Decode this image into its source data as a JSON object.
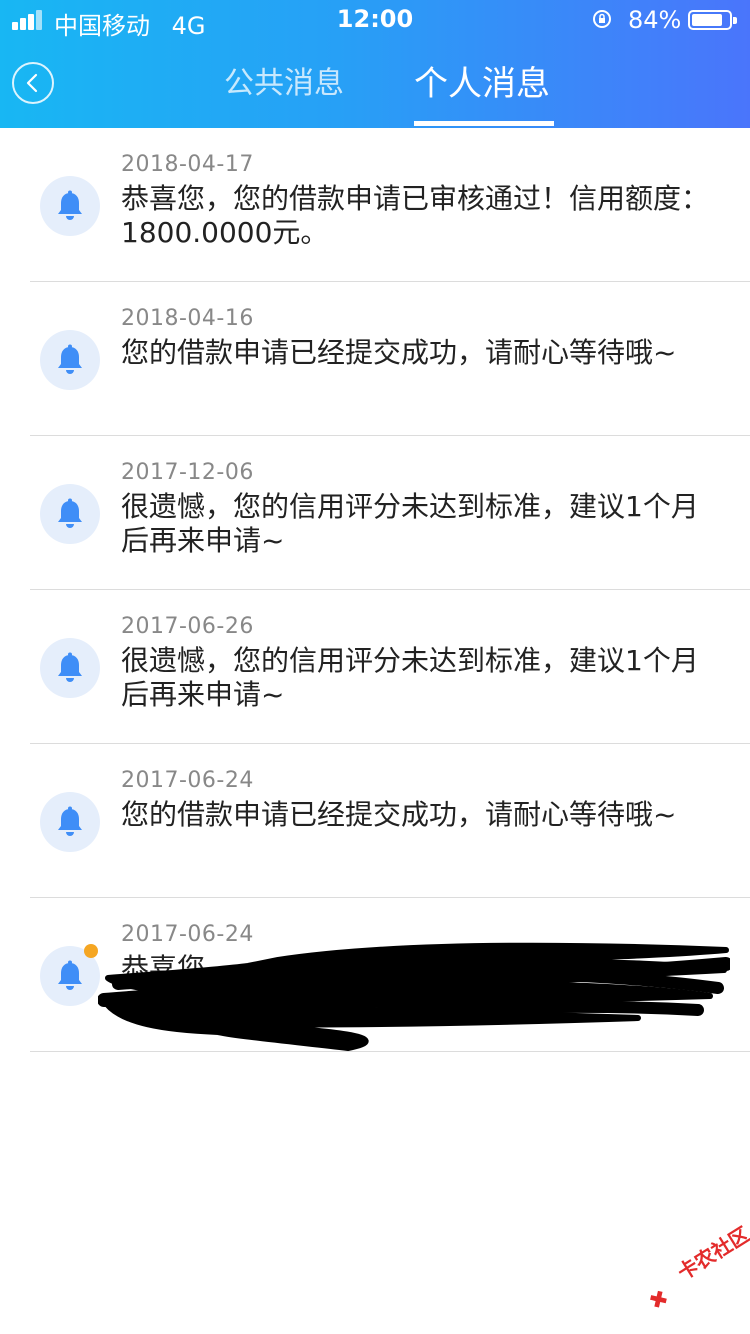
{
  "status_bar": {
    "carrier": "中国移动",
    "network": "4G",
    "time": "12:00",
    "battery_percent": "84%",
    "battery_level": 0.84
  },
  "header": {
    "tabs": [
      {
        "label": "公共消息",
        "active": false
      },
      {
        "label": "个人消息",
        "active": true
      }
    ]
  },
  "messages": [
    {
      "date": "2018-04-17",
      "text": "恭喜您，您的借款申请已审核通过！信用额度：1800.0000元。",
      "unread": false
    },
    {
      "date": "2018-04-16",
      "text": "您的借款申请已经提交成功，请耐心等待哦~",
      "unread": false
    },
    {
      "date": "2017-12-06",
      "text": "很遗憾，您的信用评分未达到标准，建议1个月后再来申请~",
      "unread": false
    },
    {
      "date": "2017-06-26",
      "text": "很遗憾，您的信用评分未达到标准，建议1个月后再来申请~",
      "unread": false
    },
    {
      "date": "2017-06-24",
      "text": "您的借款申请已经提交成功，请耐心等待哦~",
      "unread": false
    },
    {
      "date": "2017-06-24",
      "text": "恭喜您",
      "unread": true
    }
  ],
  "watermark": {
    "text": "卡农社区"
  },
  "colors": {
    "header_gradient_start": "#18b7f3",
    "header_gradient_end": "#4a75fb",
    "bell": "#3f8ef7",
    "unread_dot": "#f5a623"
  }
}
